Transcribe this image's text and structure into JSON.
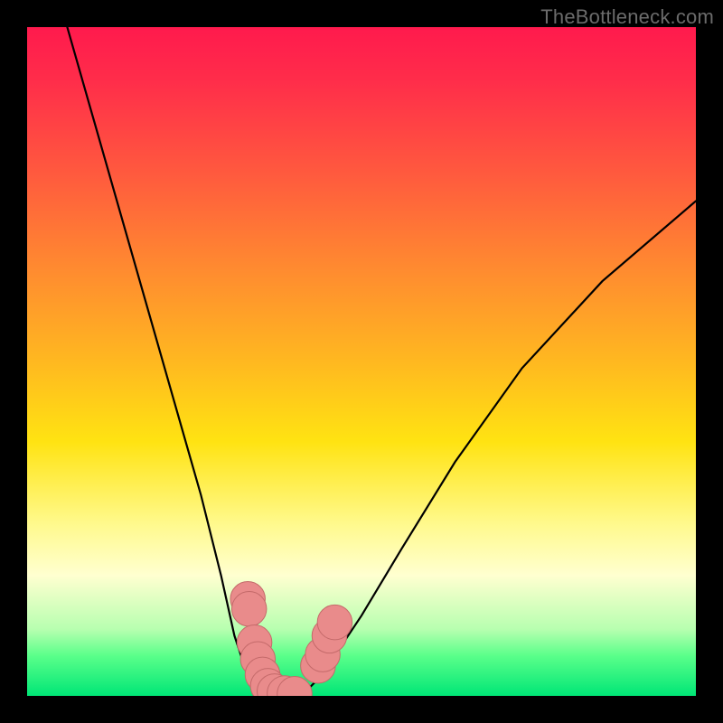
{
  "watermark": {
    "text": "TheBottleneck.com"
  },
  "chart_data": {
    "type": "line",
    "title": "",
    "xlabel": "",
    "ylabel": "",
    "xlim": [
      0,
      100
    ],
    "ylim": [
      0,
      100
    ],
    "grid": false,
    "background_gradient": {
      "stops": [
        {
          "pos": 0,
          "color": "#ff1a4d"
        },
        {
          "pos": 50,
          "color": "#ffb820"
        },
        {
          "pos": 80,
          "color": "#fff98a"
        },
        {
          "pos": 100,
          "color": "#00e676"
        }
      ]
    },
    "series": [
      {
        "name": "left-branch",
        "x": [
          6,
          10,
          14,
          18,
          22,
          26,
          29,
          31,
          33,
          34,
          35
        ],
        "y": [
          100,
          86,
          72,
          58,
          44,
          30,
          18,
          9,
          3,
          1,
          0
        ]
      },
      {
        "name": "flat-bottom",
        "x": [
          35,
          37,
          39,
          41
        ],
        "y": [
          0,
          0,
          0,
          0
        ]
      },
      {
        "name": "right-branch",
        "x": [
          41,
          43,
          46,
          50,
          56,
          64,
          74,
          86,
          100
        ],
        "y": [
          0,
          2,
          6,
          12,
          22,
          35,
          49,
          62,
          74
        ]
      }
    ],
    "markers": [
      {
        "name": "left-marker-group",
        "x": 33.0,
        "y": 14.5,
        "r": 2.6
      },
      {
        "name": "left-marker-group",
        "x": 33.2,
        "y": 13.0,
        "r": 2.6
      },
      {
        "name": "left-marker-group",
        "x": 34.0,
        "y": 8.0,
        "r": 2.6
      },
      {
        "name": "left-marker-group",
        "x": 34.5,
        "y": 5.5,
        "r": 2.6
      },
      {
        "name": "left-marker-group",
        "x": 35.2,
        "y": 3.2,
        "r": 2.6
      },
      {
        "name": "left-marker-group",
        "x": 36.0,
        "y": 1.5,
        "r": 2.6
      },
      {
        "name": "left-marker-group",
        "x": 37.0,
        "y": 0.7,
        "r": 2.6
      },
      {
        "name": "left-marker-group",
        "x": 38.5,
        "y": 0.4,
        "r": 2.6
      },
      {
        "name": "left-marker-group",
        "x": 40.0,
        "y": 0.3,
        "r": 2.6
      },
      {
        "name": "right-marker-group",
        "x": 43.5,
        "y": 4.5,
        "r": 2.6
      },
      {
        "name": "right-marker-group",
        "x": 44.2,
        "y": 6.2,
        "r": 2.6
      },
      {
        "name": "right-marker-group",
        "x": 45.2,
        "y": 9.0,
        "r": 2.6
      },
      {
        "name": "right-marker-group",
        "x": 46.0,
        "y": 11.0,
        "r": 2.6
      }
    ],
    "colors": {
      "curve": "#000000",
      "marker_fill": "#e98b8b",
      "marker_stroke": "#c46a6a"
    }
  }
}
